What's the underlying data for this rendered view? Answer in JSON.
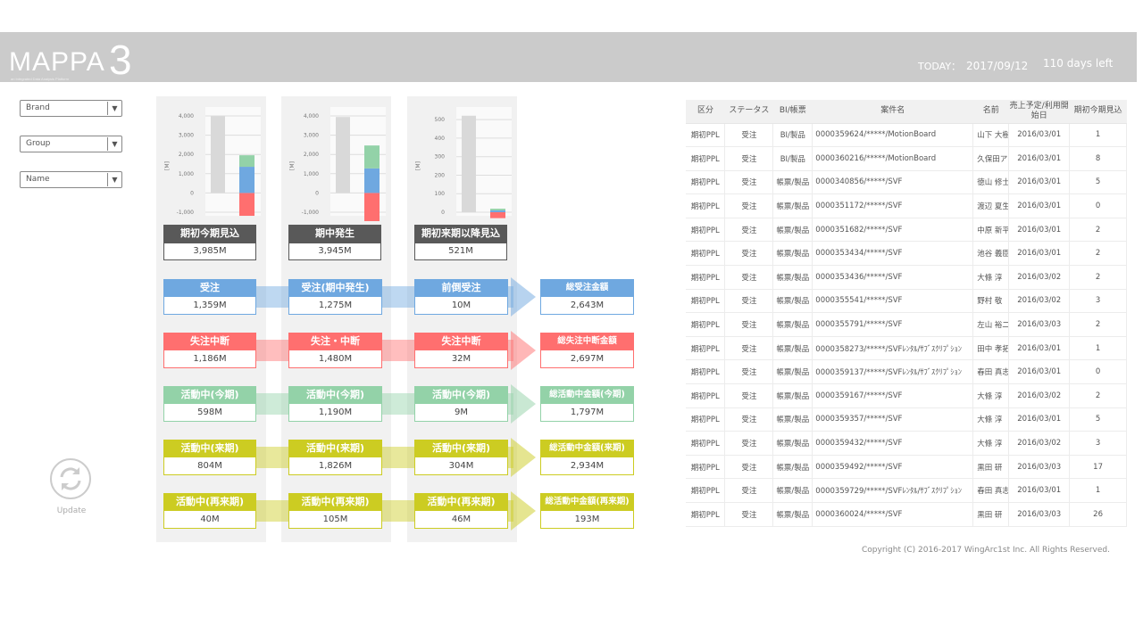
{
  "header": {
    "logo": "MAPPA",
    "logo_num": "3",
    "tagline": "an Integrated Data Analysis Platform",
    "today_label": "TODAY：",
    "today": "2017/09/12",
    "days_left": "110 days left"
  },
  "filters": [
    {
      "label": "Brand"
    },
    {
      "label": "Group"
    },
    {
      "label": "Name"
    }
  ],
  "update_label": "Update",
  "colors": {
    "blue": "#6fa8e0",
    "red": "#ff6f6f",
    "green": "#93d2a8",
    "yellow": "#cccc22",
    "gray_bar": "#d9d9d9"
  },
  "panels": [
    {
      "title": "期初今期見込",
      "value": "3,985M"
    },
    {
      "title": "期中発生",
      "value": "3,945M"
    },
    {
      "title": "期初来期以降見込",
      "value": "521M"
    }
  ],
  "chart_data": [
    {
      "type": "bar",
      "ylabel": "[M]",
      "ylim": [
        -1000,
        4000
      ],
      "ticks": [
        -1000,
        0,
        1000,
        2000,
        3000,
        4000
      ],
      "tick_labels": [
        "-1,000",
        "0",
        "1,000",
        "2,000",
        "3,000",
        "4,000"
      ],
      "total": 3985,
      "stack": {
        "red": -1186,
        "blue": 1359,
        "green": 598
      }
    },
    {
      "type": "bar",
      "ylabel": "[M]",
      "ylim": [
        -1000,
        4000
      ],
      "ticks": [
        -1000,
        0,
        1000,
        2000,
        3000,
        4000
      ],
      "tick_labels": [
        "-1,000",
        "0",
        "1,000",
        "2,000",
        "3,000",
        "4,000"
      ],
      "total": 3945,
      "stack": {
        "red": -1480,
        "blue": 1275,
        "green": 1190
      }
    },
    {
      "type": "bar",
      "ylabel": "[M]",
      "ylim": [
        0,
        520
      ],
      "ticks": [
        0,
        100,
        200,
        300,
        400,
        500
      ],
      "tick_labels": [
        "0",
        "100",
        "200",
        "300",
        "400",
        "500"
      ],
      "total": 521,
      "stack": {
        "red": -32,
        "blue": 10,
        "green": 9
      }
    }
  ],
  "flows": [
    {
      "color": "blue",
      "cells": [
        {
          "label": "受注",
          "value": "1,359M"
        },
        {
          "label": "受注(期中発生)",
          "value": "1,275M"
        },
        {
          "label": "前倒受注",
          "value": "10M"
        },
        {
          "label": "総受注金額",
          "value": "2,643M"
        }
      ]
    },
    {
      "color": "red",
      "cells": [
        {
          "label": "失注中断",
          "value": "1,186M"
        },
        {
          "label": "失注・中断",
          "value": "1,480M"
        },
        {
          "label": "失注中断",
          "value": "32M"
        },
        {
          "label": "総失注中断金額",
          "value": "2,697M"
        }
      ]
    },
    {
      "color": "green",
      "cells": [
        {
          "label": "活動中(今期)",
          "value": "598M"
        },
        {
          "label": "活動中(今期)",
          "value": "1,190M"
        },
        {
          "label": "活動中(今期)",
          "value": "9M"
        },
        {
          "label": "総活動中金額(今期)",
          "value": "1,797M"
        }
      ]
    },
    {
      "color": "yellow",
      "cells": [
        {
          "label": "活動中(来期)",
          "value": "804M"
        },
        {
          "label": "活動中(来期)",
          "value": "1,826M"
        },
        {
          "label": "活動中(来期)",
          "value": "304M"
        },
        {
          "label": "総活動中金額(来期)",
          "value": "2,934M"
        }
      ]
    },
    {
      "color": "yellow",
      "cells": [
        {
          "label": "活動中(再来期)",
          "value": "40M"
        },
        {
          "label": "活動中(再来期)",
          "value": "105M"
        },
        {
          "label": "活動中(再来期)",
          "value": "46M"
        },
        {
          "label": "総活動中金額(再来期)",
          "value": "193M"
        }
      ]
    }
  ],
  "table": {
    "headers": [
      "区分",
      "ステータス",
      "BI/帳票",
      "案件名",
      "名前",
      "売上予定/利用開始日",
      "期初今期見込"
    ],
    "rows": [
      [
        "期初PPL",
        "受注",
        "BI/製品",
        "0000359624/*****/MotionBoard",
        "山下 大樹",
        "2016/03/01",
        "1"
      ],
      [
        "期初PPL",
        "受注",
        "BI/製品",
        "0000360216/*****/MotionBoard",
        "久保田アフ",
        "2016/03/01",
        "8"
      ],
      [
        "期初PPL",
        "受注",
        "帳票/製品",
        "0000340856/*****/SVF",
        "徳山 修士",
        "2016/03/01",
        "5"
      ],
      [
        "期初PPL",
        "受注",
        "帳票/製品",
        "0000351172/*****/SVF",
        "渡辺 夏生",
        "2016/03/01",
        "0"
      ],
      [
        "期初PPL",
        "受注",
        "帳票/製品",
        "0000351682/*****/SVF",
        "中原 新平",
        "2016/03/01",
        "2"
      ],
      [
        "期初PPL",
        "受注",
        "帳票/製品",
        "0000353434/*****/SVF",
        "池谷 義臣",
        "2016/03/01",
        "2"
      ],
      [
        "期初PPL",
        "受注",
        "帳票/製品",
        "0000353436/*****/SVF",
        "大條 淳",
        "2016/03/02",
        "2"
      ],
      [
        "期初PPL",
        "受注",
        "帳票/製品",
        "0000355541/*****/SVF",
        "野村 敬",
        "2016/03/02",
        "3"
      ],
      [
        "期初PPL",
        "受注",
        "帳票/製品",
        "0000355791/*****/SVF",
        "左山 裕二",
        "2016/03/03",
        "2"
      ],
      [
        "期初PPL",
        "受注",
        "帳票/製品",
        "0000358273/*****/SVFﾚﾝﾀﾙ/ｻﾌﾞｽｸﾘﾌﾟｼｮﾝ",
        "田中 孝拓",
        "2016/03/01",
        "1"
      ],
      [
        "期初PPL",
        "受注",
        "帳票/製品",
        "0000359137/*****/SVFﾚﾝﾀﾙ/ｻﾌﾞｽｸﾘﾌﾟｼｮﾝ",
        "春田 真志",
        "2016/03/01",
        "0"
      ],
      [
        "期初PPL",
        "受注",
        "帳票/製品",
        "0000359167/*****/SVF",
        "大條 淳",
        "2016/03/02",
        "2"
      ],
      [
        "期初PPL",
        "受注",
        "帳票/製品",
        "0000359357/*****/SVF",
        "大條 淳",
        "2016/03/01",
        "5"
      ],
      [
        "期初PPL",
        "受注",
        "帳票/製品",
        "0000359432/*****/SVF",
        "大條 淳",
        "2016/03/02",
        "3"
      ],
      [
        "期初PPL",
        "受注",
        "帳票/製品",
        "0000359492/*****/SVF",
        "黒田 研",
        "2016/03/03",
        "17"
      ],
      [
        "期初PPL",
        "受注",
        "帳票/製品",
        "0000359729/*****/SVFﾚﾝﾀﾙ/ｻﾌﾞｽｸﾘﾌﾟｼｮﾝ",
        "春田 真志",
        "2016/03/01",
        "1"
      ],
      [
        "期初PPL",
        "受注",
        "帳票/製品",
        "0000360024/*****/SVF",
        "黒田 研",
        "2016/03/03",
        "26"
      ]
    ]
  },
  "copyright": "Copyright (C) 2016-2017 WingArc1st Inc. All Rights Reserved."
}
